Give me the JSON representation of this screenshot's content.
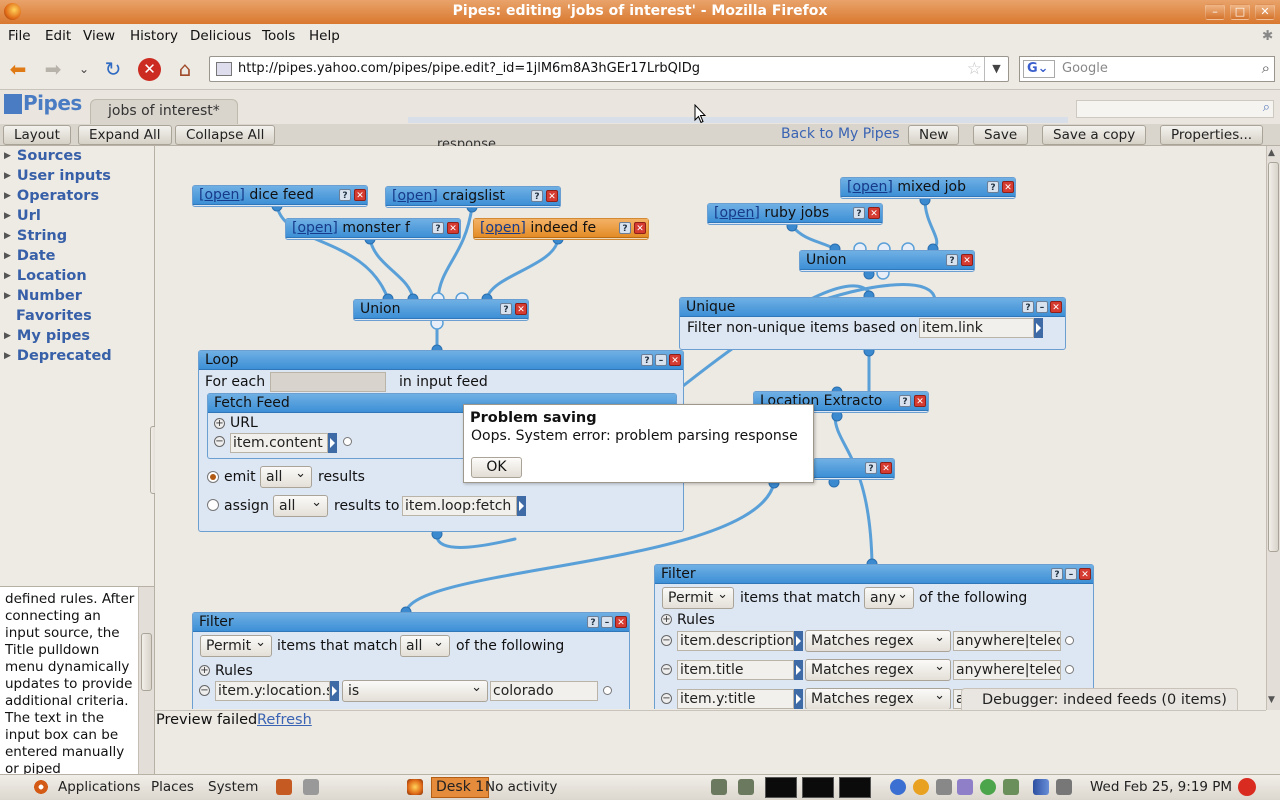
{
  "window": {
    "title": "Pipes: editing 'jobs of interest' - Mozilla Firefox",
    "minimize": "–",
    "maximize": "□",
    "close": "✕"
  },
  "menu": [
    "File",
    "Edit",
    "View",
    "History",
    "Delicious",
    "Tools",
    "Help"
  ],
  "nav": {
    "url": "http://pipes.yahoo.com/pipes/pipe.edit?_id=1jlM6m8A3hGEr17LrbQIDg",
    "search_engine": "G",
    "search_placeholder": "Google"
  },
  "pipes": {
    "logo": "Pipes",
    "tab": "jobs of interest*",
    "toolbar": {
      "layout": "Layout",
      "expand": "Expand All",
      "collapse": "Collapse All",
      "back": "Back to My Pipes",
      "new": "New",
      "save": "Save",
      "save_copy": "Save a copy",
      "properties": "Properties..."
    },
    "library": [
      "Sources",
      "User inputs",
      "Operators",
      "Url",
      "String",
      "Date",
      "Location",
      "Number",
      "Favorites",
      "My pipes",
      "Deprecated"
    ],
    "help_text": "defined rules. After connecting an input source, the Title pulldown menu dynamically updates to provide additional criteria. The text in the input box can be entered manually or piped",
    "ghost_text": "response"
  },
  "modules": {
    "dice": {
      "open": "[open]",
      "name": "dice feed"
    },
    "craigslist": {
      "open": "[open]",
      "name": "craigslist"
    },
    "monster": {
      "open": "[open]",
      "name": "monster f"
    },
    "indeed": {
      "open": "[open]",
      "name": "indeed fe"
    },
    "mixed": {
      "open": "[open]",
      "name": "mixed job"
    },
    "ruby": {
      "open": "[open]",
      "name": "ruby jobs"
    },
    "union1": "Union",
    "union2": "Union",
    "unique": {
      "title": "Unique",
      "label": "Filter non-unique items based on",
      "field": "item.link"
    },
    "location": "Location Extracto",
    "loop": {
      "title": "Loop",
      "for_each": "For each",
      "in_feed": "in input feed",
      "inner_title": "Fetch Feed",
      "url_label": "URL",
      "url_value": "item.content",
      "emit": "emit",
      "emit_sel": "all",
      "emit_results": "results",
      "assign": "assign",
      "assign_sel": "all",
      "results_to": "results to",
      "assign_field": "item.loop:fetch"
    },
    "filter1": {
      "title": "Filter",
      "mode": "Permit",
      "items_match": "items that match",
      "match": "all",
      "of_following": "of the following",
      "rules": "Rules",
      "rule1": {
        "field": "item.y:location.s",
        "op": "is",
        "value": "colorado"
      }
    },
    "filter2": {
      "title": "Filter",
      "mode": "Permit",
      "items_match": "items that match",
      "match": "any",
      "of_following": "of the following",
      "rules": "Rules",
      "rows": [
        {
          "field": "item.description",
          "op": "Matches regex",
          "value": "anywhere|telec"
        },
        {
          "field": "item.title",
          "op": "Matches regex",
          "value": "anywhere|telec"
        },
        {
          "field": "item.y:title",
          "op": "Matches regex",
          "value": "a"
        }
      ]
    }
  },
  "dialog": {
    "title": "Problem saving",
    "message": "Oops. System error: problem parsing response",
    "ok": "OK"
  },
  "debugger": "Debugger: indeed feeds (0 items)",
  "preview": {
    "failed": "Preview failed",
    "refresh": "Refresh"
  },
  "taskbar": {
    "applications": "Applications",
    "places": "Places",
    "system": "System",
    "desk": "Desk 1",
    "activity": "No activity",
    "clock": "Wed Feb 25,  9:19 PM"
  },
  "colors": {
    "accent": "#3d8fd6",
    "titlebar": "#d9782f",
    "orange_module": "#e48c26",
    "close_red": "#d53b31"
  }
}
